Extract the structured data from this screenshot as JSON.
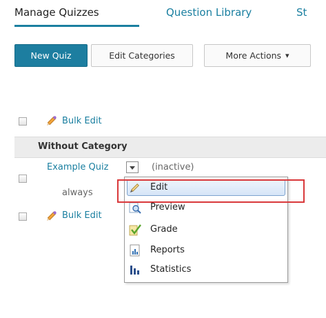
{
  "tabs": {
    "active_label": "Manage Quizzes",
    "library_label": "Question Library",
    "stats_label": "St"
  },
  "toolbar": {
    "new_quiz": "New Quiz",
    "edit_categories": "Edit Categories",
    "more_actions": "More Actions",
    "more_actions_arrow": "▾"
  },
  "list": {
    "bulk_edit_top": "Bulk Edit",
    "category": "Without Category",
    "quiz_name": "Example Quiz",
    "quiz_status": "(inactive)",
    "availability": "always",
    "bulk_edit_bottom": "Bulk Edit"
  },
  "context_menu": {
    "items": [
      {
        "label": "Edit",
        "icon": "pencil-icon"
      },
      {
        "label": "Preview",
        "icon": "magnifier-icon"
      },
      {
        "label": "Grade",
        "icon": "grade-checkmark-icon"
      },
      {
        "label": "Reports",
        "icon": "reports-icon"
      },
      {
        "label": "Statistics",
        "icon": "statistics-icon"
      }
    ]
  },
  "colors": {
    "accent": "#1a7fa0",
    "primary_button": "#1d7ea0",
    "highlight": "#d9383a"
  }
}
